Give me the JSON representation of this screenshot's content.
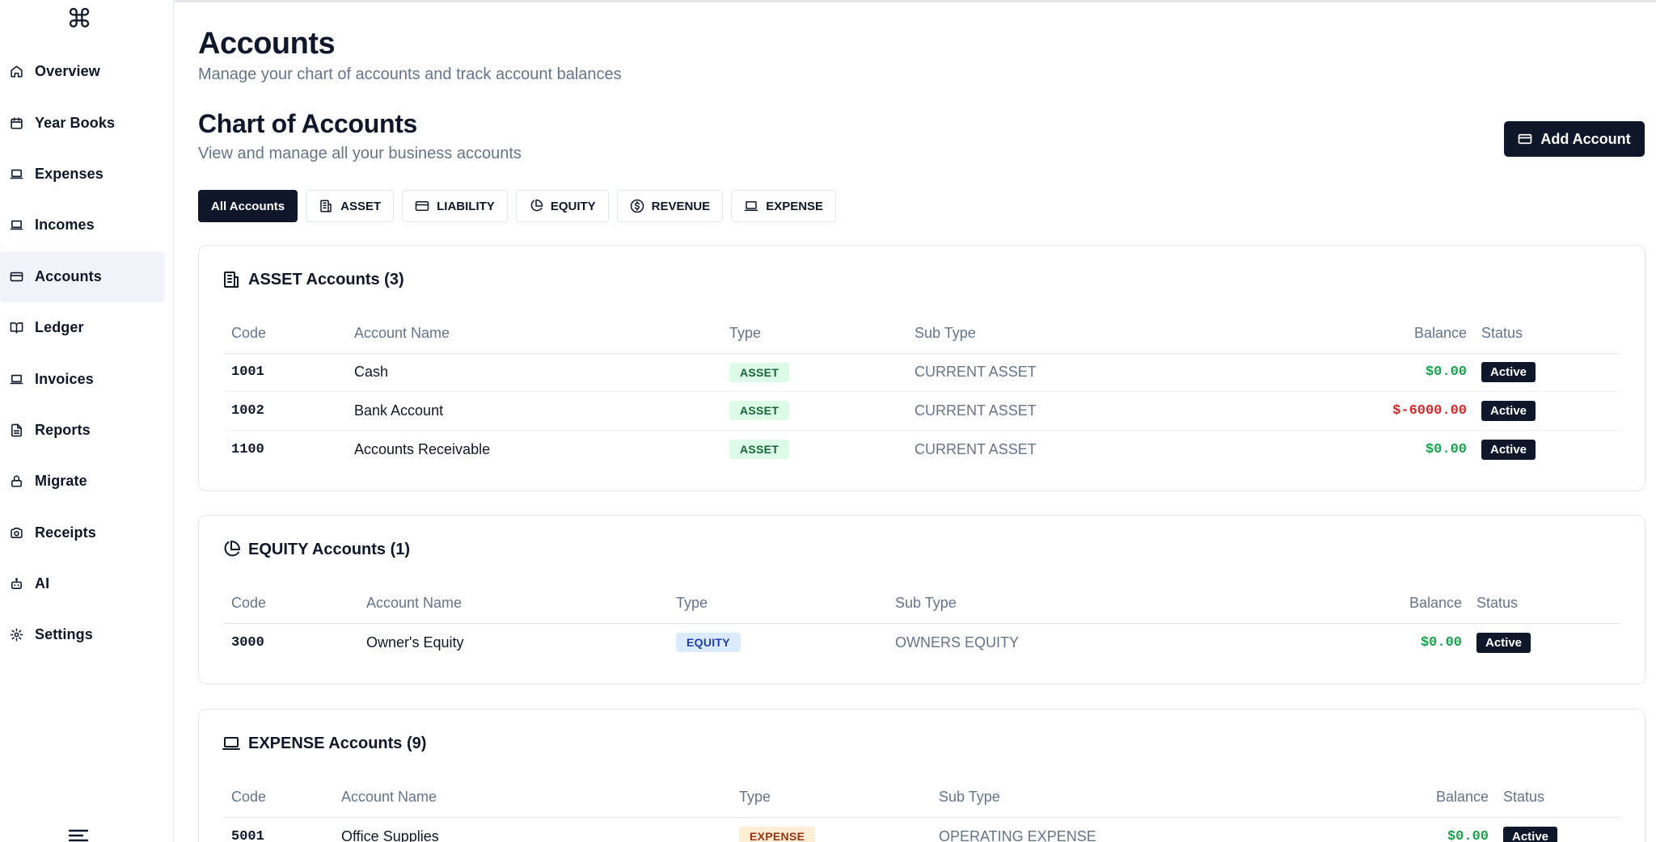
{
  "app": {
    "logo": "⌘"
  },
  "sidebar": {
    "items": [
      {
        "label": "Overview",
        "icon": "home-icon"
      },
      {
        "label": "Year Books",
        "icon": "calendar-icon"
      },
      {
        "label": "Expenses",
        "icon": "laptop-icon"
      },
      {
        "label": "Incomes",
        "icon": "laptop-icon"
      },
      {
        "label": "Accounts",
        "icon": "credit-card-icon",
        "active": true
      },
      {
        "label": "Ledger",
        "icon": "book-open-icon"
      },
      {
        "label": "Invoices",
        "icon": "laptop-icon"
      },
      {
        "label": "Reports",
        "icon": "file-text-icon"
      },
      {
        "label": "Migrate",
        "icon": "lock-icon"
      },
      {
        "label": "Receipts",
        "icon": "camera-icon"
      },
      {
        "label": "AI",
        "icon": "bot-icon"
      },
      {
        "label": "Settings",
        "icon": "gear-icon"
      }
    ]
  },
  "header": {
    "title": "Accounts",
    "subtitle": "Manage your chart of accounts and track account balances"
  },
  "section": {
    "title": "Chart of Accounts",
    "subtitle": "View and manage all your business accounts",
    "add_label": "Add Account"
  },
  "filters": [
    {
      "label": "All Accounts",
      "icon": "",
      "active": true
    },
    {
      "label": "ASSET",
      "icon": "building-icon"
    },
    {
      "label": "LIABILITY",
      "icon": "credit-card-icon"
    },
    {
      "label": "EQUITY",
      "icon": "pie-chart-icon"
    },
    {
      "label": "REVENUE",
      "icon": "dollar-circle-icon"
    },
    {
      "label": "EXPENSE",
      "icon": "laptop-icon"
    }
  ],
  "columns": {
    "code": "Code",
    "name": "Account Name",
    "type": "Type",
    "subtype": "Sub Type",
    "balance": "Balance",
    "status": "Status"
  },
  "groups": {
    "asset": {
      "title": "ASSET Accounts (3)",
      "rows": [
        {
          "code": "1001",
          "name": "Cash",
          "type": "ASSET",
          "subtype": "CURRENT ASSET",
          "balance": "$0.00",
          "status": "Active"
        },
        {
          "code": "1002",
          "name": "Bank Account",
          "type": "ASSET",
          "subtype": "CURRENT ASSET",
          "balance": "$-6000.00",
          "status": "Active"
        },
        {
          "code": "1100",
          "name": "Accounts Receivable",
          "type": "ASSET",
          "subtype": "CURRENT ASSET",
          "balance": "$0.00",
          "status": "Active"
        }
      ]
    },
    "equity": {
      "title": "EQUITY Accounts (1)",
      "rows": [
        {
          "code": "3000",
          "name": "Owner's Equity",
          "type": "EQUITY",
          "subtype": "OWNERS EQUITY",
          "balance": "$0.00",
          "status": "Active"
        }
      ]
    },
    "expense": {
      "title": "EXPENSE Accounts (9)",
      "rows": [
        {
          "code": "5001",
          "name": "Office Supplies",
          "type": "EXPENSE",
          "subtype": "OPERATING EXPENSE",
          "balance": "$0.00",
          "status": "Active"
        }
      ]
    }
  },
  "colors": {
    "primary": "#0f172a",
    "positive": "#16a34a",
    "negative": "#dc2626",
    "muted": "#64748b"
  }
}
